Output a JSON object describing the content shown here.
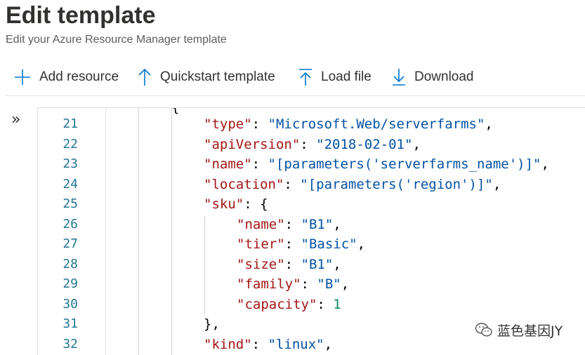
{
  "header": {
    "title": "Edit template",
    "subtitle": "Edit your Azure Resource Manager template"
  },
  "toolbar": {
    "add_resource": "Add resource",
    "quickstart_template": "Quickstart template",
    "load_file": "Load file",
    "download": "Download"
  },
  "editor": {
    "expand_glyph": "»",
    "top_fragment": "{",
    "lines": [
      {
        "num": "21",
        "indent": 2,
        "tokens": [
          {
            "t": "\"type\"",
            "c": "k"
          },
          {
            "t": ": ",
            "c": "p"
          },
          {
            "t": "\"Microsoft.Web/serverfarms\"",
            "c": "s"
          },
          {
            "t": ",",
            "c": "p"
          }
        ]
      },
      {
        "num": "22",
        "indent": 2,
        "tokens": [
          {
            "t": "\"apiVersion\"",
            "c": "k"
          },
          {
            "t": ": ",
            "c": "p"
          },
          {
            "t": "\"2018-02-01\"",
            "c": "s"
          },
          {
            "t": ",",
            "c": "p"
          }
        ]
      },
      {
        "num": "23",
        "indent": 2,
        "tokens": [
          {
            "t": "\"name\"",
            "c": "k"
          },
          {
            "t": ": ",
            "c": "p"
          },
          {
            "t": "\"[parameters('serverfarms_name')]\"",
            "c": "s"
          },
          {
            "t": ",",
            "c": "p"
          }
        ]
      },
      {
        "num": "24",
        "indent": 2,
        "tokens": [
          {
            "t": "\"location\"",
            "c": "k"
          },
          {
            "t": ": ",
            "c": "p"
          },
          {
            "t": "\"[parameters('region')]\"",
            "c": "s"
          },
          {
            "t": ",",
            "c": "p"
          }
        ]
      },
      {
        "num": "25",
        "indent": 2,
        "tokens": [
          {
            "t": "\"sku\"",
            "c": "k"
          },
          {
            "t": ": {",
            "c": "p"
          }
        ]
      },
      {
        "num": "26",
        "indent": 3,
        "tokens": [
          {
            "t": "\"name\"",
            "c": "k"
          },
          {
            "t": ": ",
            "c": "p"
          },
          {
            "t": "\"B1\"",
            "c": "s"
          },
          {
            "t": ",",
            "c": "p"
          }
        ]
      },
      {
        "num": "27",
        "indent": 3,
        "tokens": [
          {
            "t": "\"tier\"",
            "c": "k"
          },
          {
            "t": ": ",
            "c": "p"
          },
          {
            "t": "\"Basic\"",
            "c": "s"
          },
          {
            "t": ",",
            "c": "p"
          }
        ]
      },
      {
        "num": "28",
        "indent": 3,
        "tokens": [
          {
            "t": "\"size\"",
            "c": "k"
          },
          {
            "t": ": ",
            "c": "p"
          },
          {
            "t": "\"B1\"",
            "c": "s"
          },
          {
            "t": ",",
            "c": "p"
          }
        ]
      },
      {
        "num": "29",
        "indent": 3,
        "tokens": [
          {
            "t": "\"family\"",
            "c": "k"
          },
          {
            "t": ": ",
            "c": "p"
          },
          {
            "t": "\"B\"",
            "c": "s"
          },
          {
            "t": ",",
            "c": "p"
          }
        ]
      },
      {
        "num": "30",
        "indent": 3,
        "tokens": [
          {
            "t": "\"capacity\"",
            "c": "k"
          },
          {
            "t": ": ",
            "c": "p"
          },
          {
            "t": "1",
            "c": "n"
          }
        ]
      },
      {
        "num": "31",
        "indent": 2,
        "tokens": [
          {
            "t": "},",
            "c": "p"
          }
        ]
      },
      {
        "num": "32",
        "indent": 2,
        "tokens": [
          {
            "t": "\"kind\"",
            "c": "k"
          },
          {
            "t": ": ",
            "c": "p"
          },
          {
            "t": "\"linux\"",
            "c": "s"
          },
          {
            "t": ",",
            "c": "p"
          }
        ]
      }
    ]
  },
  "watermark": {
    "text": "蓝色基因JY",
    "icon": "wechat-icon"
  },
  "colors": {
    "accent": "#0078d4",
    "line_number": "#237893",
    "json_key": "#a31515",
    "json_string": "#0451a5",
    "json_number": "#098658"
  },
  "icons": {
    "add_resource": "plus-icon",
    "quickstart_template": "arrow-up-icon",
    "load_file": "upload-icon",
    "download": "download-icon"
  }
}
